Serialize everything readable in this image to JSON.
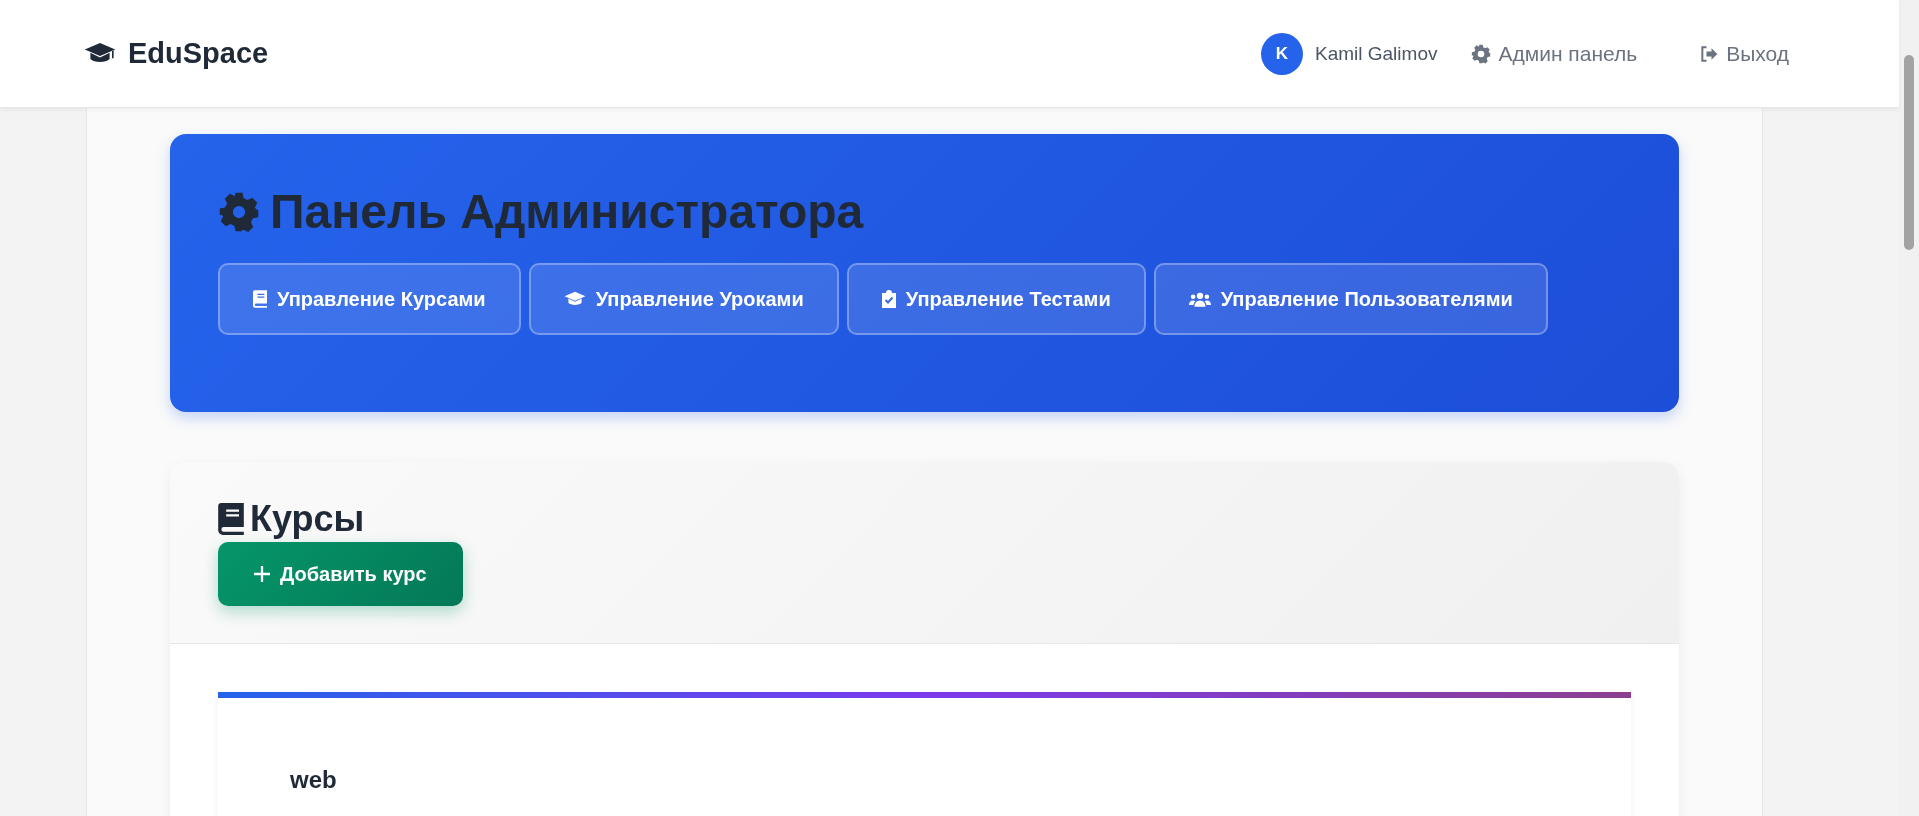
{
  "header": {
    "brand": "EduSpace",
    "user": {
      "initial": "K",
      "name": "Kamil Galimov"
    },
    "links": [
      {
        "label": "Админ панель"
      },
      {
        "label": "Выход"
      }
    ]
  },
  "admin_panel": {
    "title": "Панель Администратора",
    "buttons": [
      {
        "label": "Управление Курсами"
      },
      {
        "label": "Управление Уроками"
      },
      {
        "label": "Управление Тестами"
      },
      {
        "label": "Управление Пользователями"
      }
    ]
  },
  "courses_section": {
    "title": "Курсы",
    "add_button": "Добавить курс",
    "courses": [
      {
        "title": "web"
      }
    ]
  }
}
